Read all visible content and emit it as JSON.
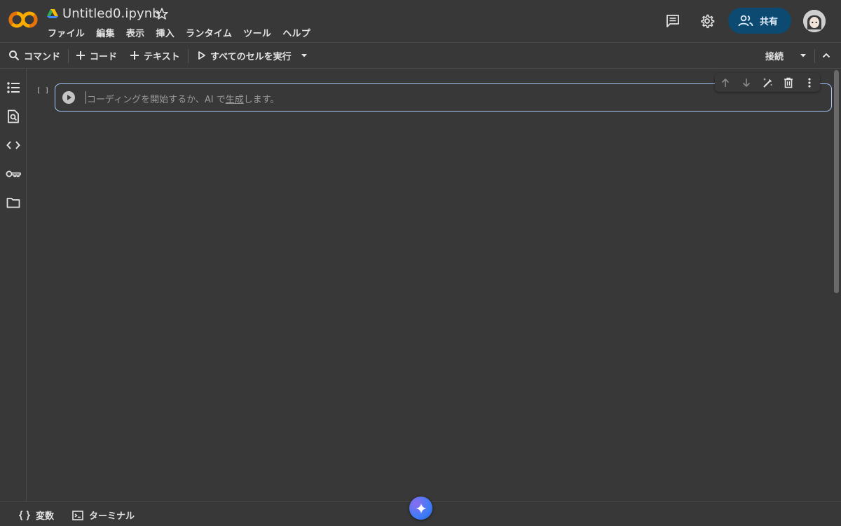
{
  "header": {
    "logo_text": "CO",
    "doc_title": "Untitled0.ipynb",
    "menu": [
      "ファイル",
      "編集",
      "表示",
      "挿入",
      "ランタイム",
      "ツール",
      "ヘルプ"
    ],
    "share_label": "共有"
  },
  "toolbar": {
    "command_label": "コマンド",
    "code_label": "コード",
    "text_label": "テキスト",
    "run_all_label": "すべてのセルを実行",
    "connect_label": "接続"
  },
  "cell": {
    "bracket": "[ ]",
    "placeholder_prefix": "コーディングを開始するか、AI で",
    "placeholder_link": "生成",
    "placeholder_suffix": "します。"
  },
  "bottom": {
    "variables_label": "変数",
    "terminal_label": "ターミナル"
  },
  "colors": {
    "background": "#383838",
    "accent_border": "#a8c7fa",
    "share_button": "#0c4a72",
    "logo_orange": "#f9ab00"
  }
}
